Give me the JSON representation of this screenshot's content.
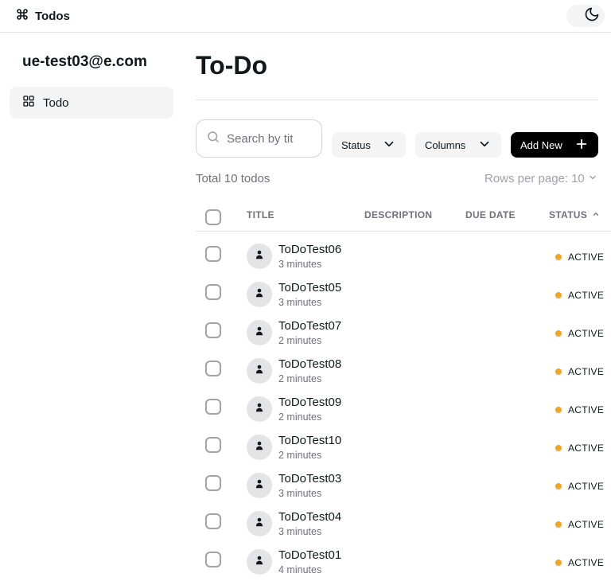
{
  "app": {
    "title": "Todos"
  },
  "sidebar": {
    "user_email": "ue-test03@e.com",
    "items": [
      {
        "label": "Todo",
        "icon": "grid-icon"
      }
    ]
  },
  "main": {
    "title": "To-Do",
    "search_placeholder": "Search by title",
    "status_filter_label": "Status",
    "columns_label": "Columns",
    "add_new_label": "Add New",
    "total_text": "Total 10 todos",
    "rows_per_page_label": "Rows per page:",
    "rows_per_page_value": "10",
    "columns": {
      "title": "TITLE",
      "description": "DESCRIPTION",
      "due_date": "DUE DATE",
      "status": "STATUS"
    },
    "rows": [
      {
        "title": "ToDoTest06",
        "time": "3 minutes",
        "status": "ACTIVE"
      },
      {
        "title": "ToDoTest05",
        "time": "3 minutes",
        "status": "ACTIVE"
      },
      {
        "title": "ToDoTest07",
        "time": "2 minutes",
        "status": "ACTIVE"
      },
      {
        "title": "ToDoTest08",
        "time": "2 minutes",
        "status": "ACTIVE"
      },
      {
        "title": "ToDoTest09",
        "time": "2 minutes",
        "status": "ACTIVE"
      },
      {
        "title": "ToDoTest10",
        "time": "2 minutes",
        "status": "ACTIVE"
      },
      {
        "title": "ToDoTest03",
        "time": "3 minutes",
        "status": "ACTIVE"
      },
      {
        "title": "ToDoTest04",
        "time": "3 minutes",
        "status": "ACTIVE"
      },
      {
        "title": "ToDoTest01",
        "time": "4 minutes",
        "status": "ACTIVE"
      }
    ]
  },
  "colors": {
    "status_active": "#f5a524",
    "primary_button": "#000000"
  }
}
